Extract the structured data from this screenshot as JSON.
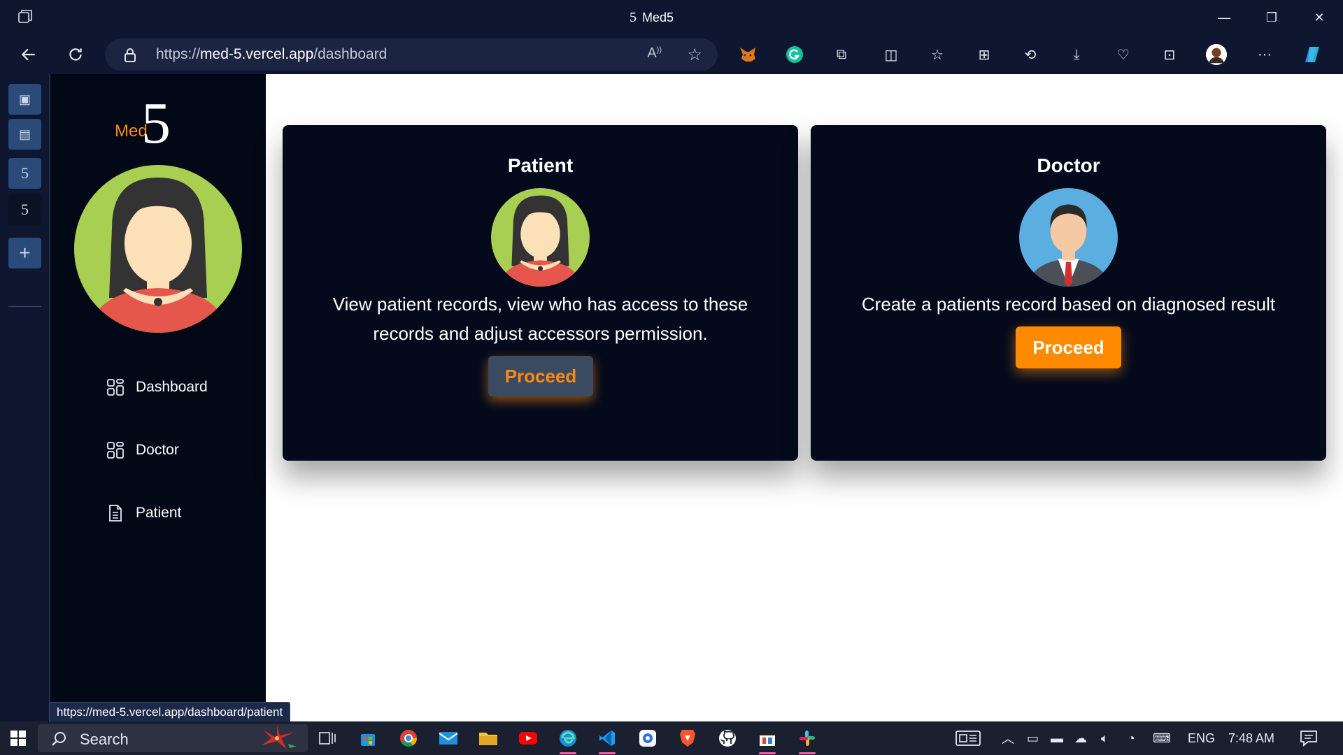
{
  "browser": {
    "tab_title": "Med5",
    "url_scheme": "https://",
    "url_host": "med-5.vercel.app",
    "url_path": "/dashboard",
    "status_url": "https://med-5.vercel.app/dashboard/patient"
  },
  "sidebar": {
    "logo_text": "Med",
    "logo_number": "5",
    "nav": [
      {
        "label": "Dashboard",
        "icon": "grid-icon"
      },
      {
        "label": "Doctor",
        "icon": "grid-icon"
      },
      {
        "label": "Patient",
        "icon": "document-icon"
      }
    ]
  },
  "cards": {
    "patient": {
      "title": "Patient",
      "description": "View patient records, view who has access to these records and adjust accessors permission.",
      "button": "Proceed"
    },
    "doctor": {
      "title": "Doctor",
      "description": "Create a patients record based on diagnosed result",
      "button": "Proceed"
    }
  },
  "taskbar": {
    "search_label": "Search",
    "language": "ENG",
    "time": "7:48 AM"
  },
  "colors": {
    "accent_orange": "#ff8a00",
    "card_bg": "#040a1c",
    "sidebar_bg": "#030816",
    "browser_chrome": "#0e1630"
  }
}
